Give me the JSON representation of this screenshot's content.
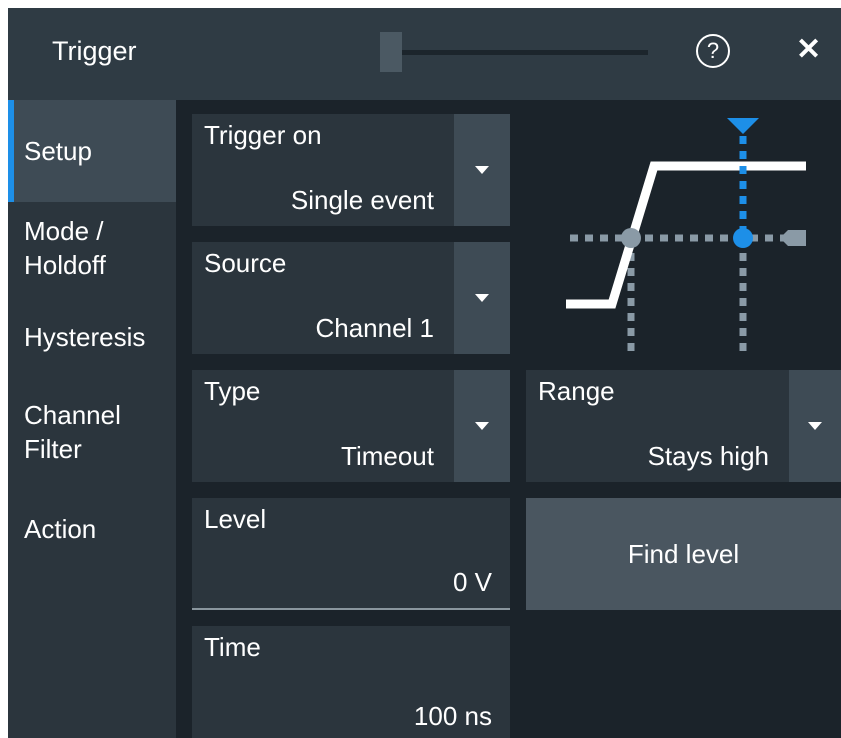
{
  "window": {
    "title": "Trigger",
    "help_icon": "question-circle-icon",
    "help_glyph": "?",
    "close_icon": "close-icon",
    "close_glyph": "✕"
  },
  "sidebar": {
    "items": [
      {
        "label": "Setup",
        "active": true
      },
      {
        "label": "Mode /\nHoldoff",
        "active": false
      },
      {
        "label": "Hysteresis",
        "active": false
      },
      {
        "label": "Channel\nFilter",
        "active": false
      },
      {
        "label": "Action",
        "active": false
      }
    ]
  },
  "settings": {
    "trigger_on": {
      "label": "Trigger on",
      "value": "Single event"
    },
    "source": {
      "label": "Source",
      "value": "Channel 1"
    },
    "type": {
      "label": "Type",
      "value": "Timeout"
    },
    "range": {
      "label": "Range",
      "value": "Stays high"
    },
    "level": {
      "label": "Level",
      "value": "0 V"
    },
    "find_level": {
      "label": "Find level"
    },
    "time": {
      "label": "Time",
      "value": "100 ns"
    }
  },
  "colors": {
    "accent": "#1d8fe8",
    "panel": "#2b353d",
    "dropdown": "#3e4b55",
    "background": "#1b232a"
  }
}
